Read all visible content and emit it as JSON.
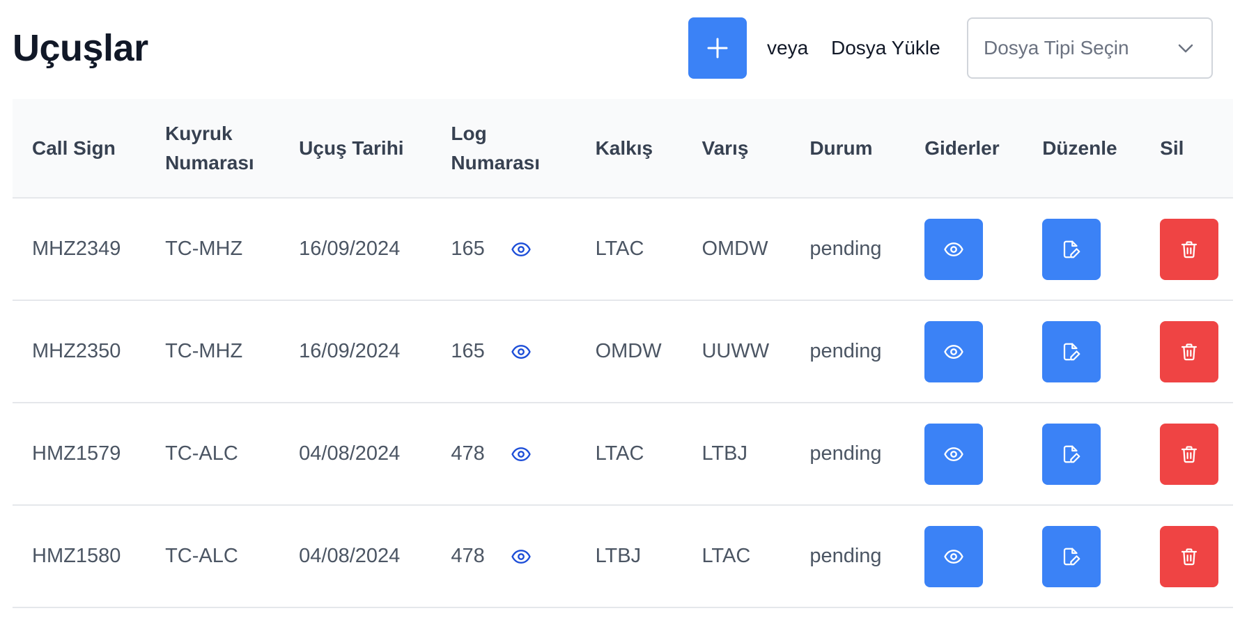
{
  "header": {
    "title": "Uçuşlar",
    "or_text": "veya",
    "upload_label": "Dosya Yükle",
    "file_type_placeholder": "Dosya Tipi Seçin"
  },
  "table": {
    "columns": [
      "Call Sign",
      "Kuyruk Numarası",
      "Uçuş Tarihi",
      "Log Numarası",
      "Kalkış",
      "Varış",
      "Durum",
      "Giderler",
      "Düzenle",
      "Sil"
    ],
    "column_lines": {
      "kuyruk_1": "Kuyruk",
      "kuyruk_2": "Numarası",
      "log_1": "Log",
      "log_2": "Numarası"
    },
    "rows": [
      {
        "call_sign": "MHZ2349",
        "tail": "TC-MHZ",
        "date": "16/09/2024",
        "log": "165",
        "dep": "LTAC",
        "arr": "OMDW",
        "status": "pending"
      },
      {
        "call_sign": "MHZ2350",
        "tail": "TC-MHZ",
        "date": "16/09/2024",
        "log": "165",
        "dep": "OMDW",
        "arr": "UUWW",
        "status": "pending"
      },
      {
        "call_sign": "HMZ1579",
        "tail": "TC-ALC",
        "date": "04/08/2024",
        "log": "478",
        "dep": "LTAC",
        "arr": "LTBJ",
        "status": "pending"
      },
      {
        "call_sign": "HMZ1580",
        "tail": "TC-ALC",
        "date": "04/08/2024",
        "log": "478",
        "dep": "LTBJ",
        "arr": "LTAC",
        "status": "pending"
      }
    ]
  },
  "colors": {
    "primary": "#3b82f6",
    "danger": "#ef4444",
    "log_eye": "#1d4ed8",
    "header_bg": "#f9fafb"
  },
  "icons": {
    "add": "plus-icon",
    "select": "chevron-down-icon",
    "log": "eye-icon",
    "expenses": "eye-icon",
    "edit": "edit-file-icon",
    "delete": "trash-icon"
  }
}
